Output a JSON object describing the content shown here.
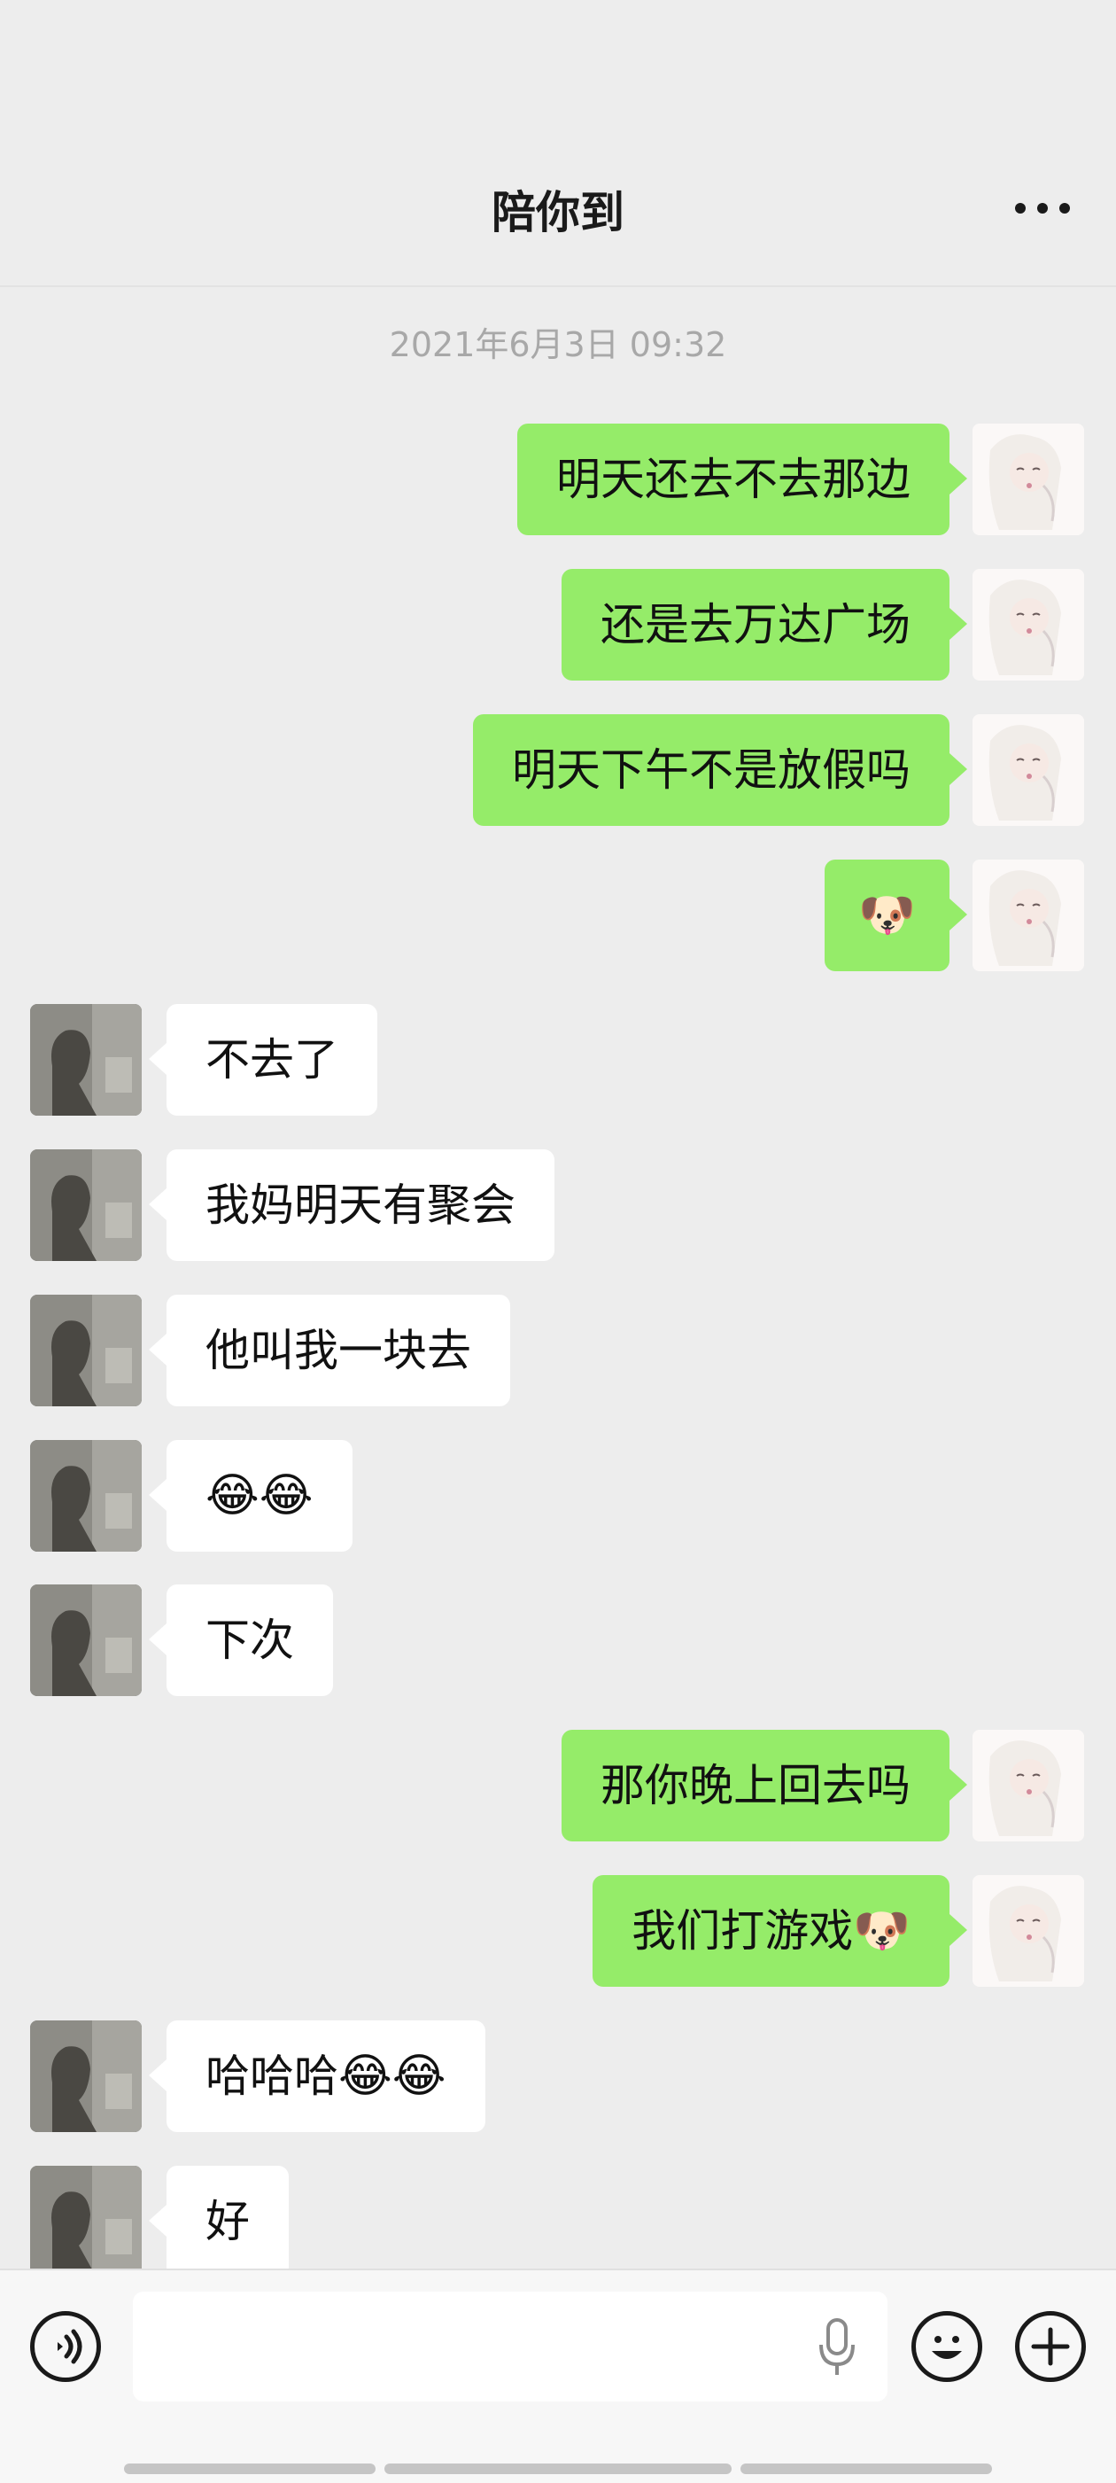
{
  "header": {
    "title": "陪你到",
    "more_icon": "more-horizontal-icon"
  },
  "chat": {
    "timestamp": "2021年6月3日 09:32",
    "messages": [
      {
        "sender": "self",
        "text": "明天还去不去那边"
      },
      {
        "sender": "self",
        "text": "还是去万达广场"
      },
      {
        "sender": "self",
        "text": "明天下午不是放假吗"
      },
      {
        "sender": "self",
        "text": "",
        "emoji": "🐶"
      },
      {
        "sender": "other",
        "text": "不去了"
      },
      {
        "sender": "other",
        "text": "我妈明天有聚会"
      },
      {
        "sender": "other",
        "text": "他叫我一块去"
      },
      {
        "sender": "other",
        "text": "",
        "emoji": "😂😂"
      },
      {
        "sender": "other",
        "text": "下次"
      },
      {
        "sender": "self",
        "text": "那你晚上回去吗"
      },
      {
        "sender": "self",
        "text": "我们打游戏",
        "emoji": "🐶"
      },
      {
        "sender": "other",
        "text": "哈哈哈",
        "emoji": "😂😂"
      },
      {
        "sender": "other",
        "text": "好"
      }
    ]
  },
  "input_bar": {
    "voice_icon": "voice-input-icon",
    "mic_icon": "microphone-icon",
    "emoji_icon": "emoji-icon",
    "plus_icon": "plus-icon",
    "input_value": ""
  },
  "colors": {
    "background": "#ededed",
    "self_bubble": "#95ec69",
    "other_bubble": "#ffffff",
    "timestamp": "#a8a8a8"
  }
}
